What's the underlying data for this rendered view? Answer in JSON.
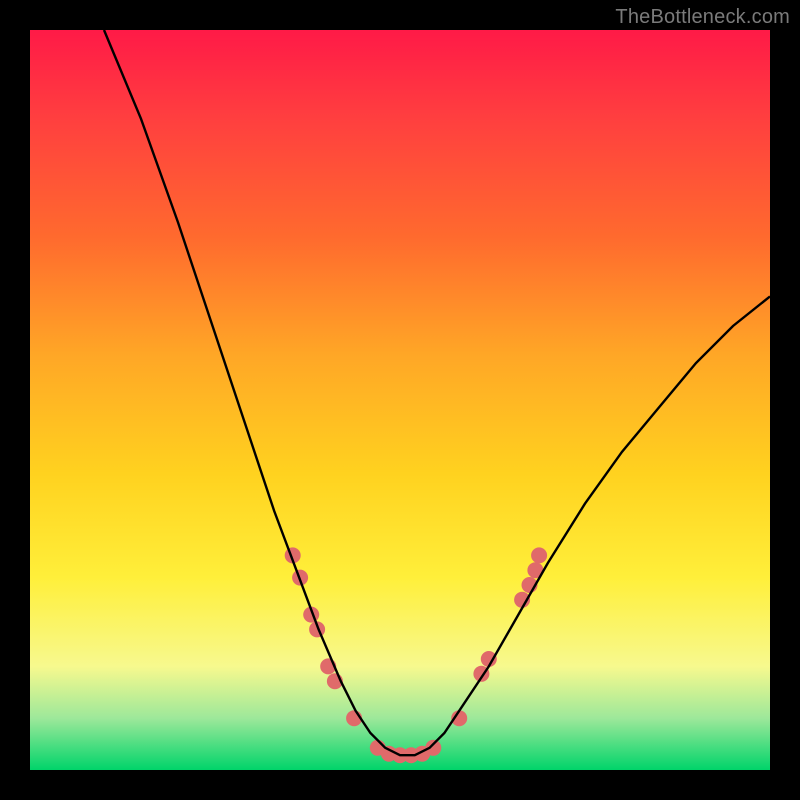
{
  "watermark": "TheBottleneck.com",
  "chart_data": {
    "type": "line",
    "title": "",
    "xlabel": "",
    "ylabel": "",
    "xlim": [
      0,
      100
    ],
    "ylim": [
      0,
      100
    ],
    "series": [
      {
        "name": "bottleneck-curve",
        "x": [
          10,
          15,
          20,
          25,
          30,
          33,
          36,
          39,
          42,
          44,
          46,
          48,
          50,
          52,
          54,
          56,
          58,
          62,
          66,
          70,
          75,
          80,
          85,
          90,
          95,
          100
        ],
        "y": [
          100,
          88,
          74,
          59,
          44,
          35,
          27,
          19,
          12,
          8,
          5,
          3,
          2,
          2,
          3,
          5,
          8,
          14,
          21,
          28,
          36,
          43,
          49,
          55,
          60,
          64
        ]
      }
    ],
    "markers": [
      {
        "x": 35.5,
        "y": 29
      },
      {
        "x": 36.5,
        "y": 26
      },
      {
        "x": 38.0,
        "y": 21
      },
      {
        "x": 38.8,
        "y": 19
      },
      {
        "x": 40.3,
        "y": 14
      },
      {
        "x": 41.2,
        "y": 12
      },
      {
        "x": 43.8,
        "y": 7
      },
      {
        "x": 47.0,
        "y": 3
      },
      {
        "x": 48.5,
        "y": 2.2
      },
      {
        "x": 50.0,
        "y": 2
      },
      {
        "x": 51.5,
        "y": 2
      },
      {
        "x": 53.0,
        "y": 2.2
      },
      {
        "x": 54.5,
        "y": 3
      },
      {
        "x": 58.0,
        "y": 7
      },
      {
        "x": 61.0,
        "y": 13
      },
      {
        "x": 62.0,
        "y": 15
      },
      {
        "x": 66.5,
        "y": 23
      },
      {
        "x": 67.5,
        "y": 25
      },
      {
        "x": 68.3,
        "y": 27
      },
      {
        "x": 68.8,
        "y": 29
      }
    ],
    "colors": {
      "curve": "#000000",
      "marker": "#e06a6a",
      "gradient_top": "#ff1a47",
      "gradient_bottom": "#00d46a"
    }
  }
}
